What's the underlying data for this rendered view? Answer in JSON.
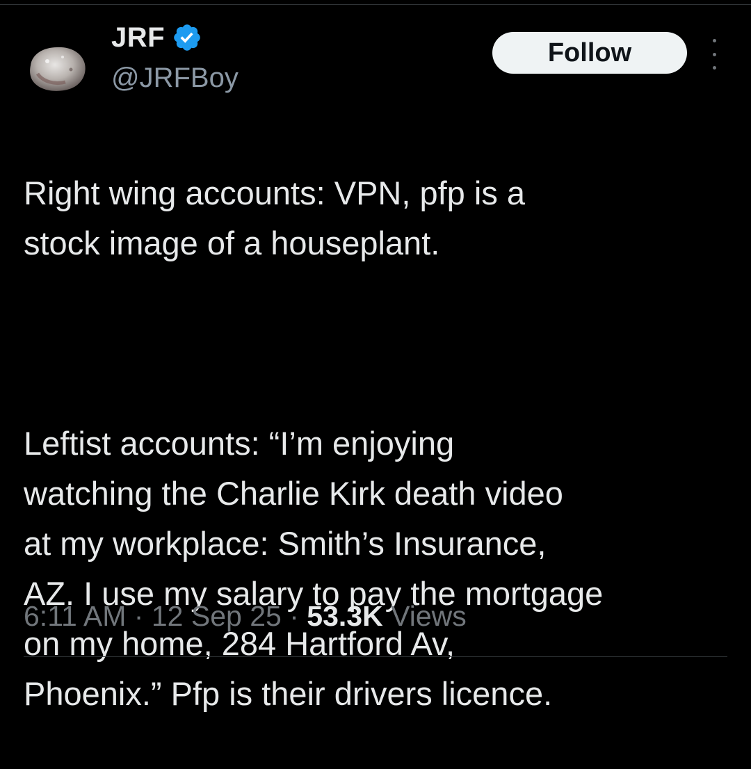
{
  "user": {
    "display_name": "JRF",
    "handle": "@JRFBoy",
    "verified_color": "#1d9bf0"
  },
  "actions": {
    "follow_label": "Follow",
    "more_icon": "more-vertical-icon"
  },
  "tweet": {
    "paragraph_1": "Right wing accounts: VPN, pfp is a\nstock image of a houseplant.",
    "paragraph_2": "Leftist accounts: “I’m enjoying\nwatching the Charlie Kirk death video\nat my workplace: Smith’s Insurance,\nAZ. I use my salary to pay the mortgage\non my home, 284 Hartford Av,\nPhoenix.” Pfp is their drivers licence."
  },
  "meta": {
    "time": "6:11 AM",
    "date": "12 Sep 25",
    "separator": "·",
    "views_count": "53.3K",
    "views_label": "Views"
  }
}
